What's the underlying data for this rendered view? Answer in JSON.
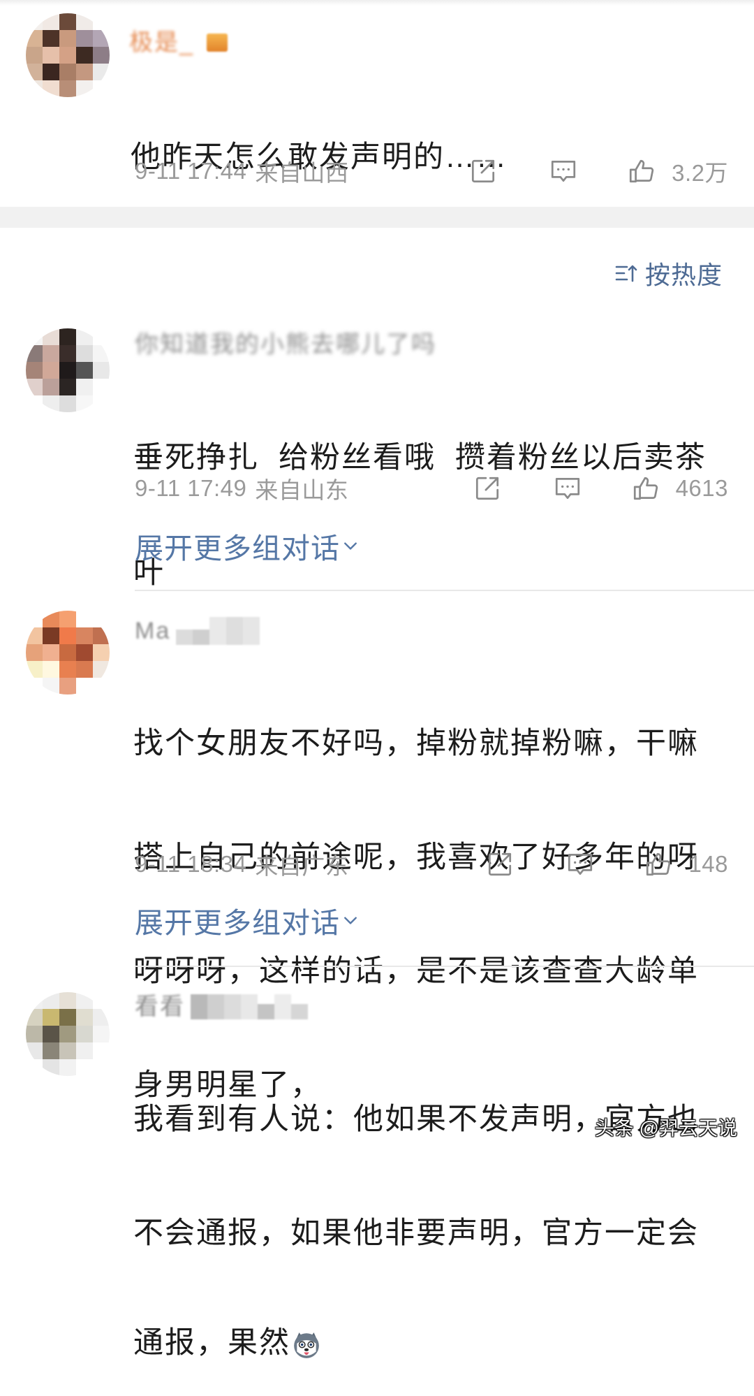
{
  "colors": {
    "text": "#1c1c1c",
    "meta": "#9a9a9a",
    "link": "#5577a6",
    "sort": "#4e6b94",
    "username_orange": "#e5894f",
    "username_gray": "#8c8c8c",
    "divider": "#e8e8e8",
    "band": "#f1f1f1"
  },
  "sort": {
    "label": "按热度",
    "icon": "sort-icon"
  },
  "icons": {
    "share": "share-icon",
    "comment": "comment-icon",
    "like": "like-icon",
    "expand": "chevron-down-icon"
  },
  "comments": [
    {
      "username": "极是_",
      "text_lines": [
        "他昨天怎么敢发声明的……"
      ],
      "time": "9-11 17:44",
      "location": "来自山西",
      "likes": "3.2万",
      "avatar_tiles": [
        "#f3efec",
        "#f1e9e4",
        "#6b4a3a",
        "#f0ebe8",
        "#ffffff",
        "#d8b394",
        "#4d3328",
        "#c99a7e",
        "#9f8f9b",
        "#b3a6b5",
        "#c9a58a",
        "#e6c0aa",
        "#d4a186",
        "#3d2a22",
        "#8d7d87",
        "#d2b29a",
        "#3b2620",
        "#a97e66",
        "#c49880",
        "#eaeaea",
        "#efe7e0",
        "#f0ddd0",
        "#b88e77",
        "#f3f0ee",
        "#ffffff"
      ]
    },
    {
      "username": "你知道我的小熊去哪儿了吗",
      "text_lines": [
        "垂死挣扎 给粉丝看哦 攒着粉丝以后卖茶",
        "叶"
      ],
      "time": "9-11 17:49",
      "location": "来自山东",
      "likes": "4613",
      "expand_label": "展开更多组对话",
      "avatar_tiles": [
        "#f5f5f5",
        "#e8dcd6",
        "#2d2420",
        "#efefef",
        "#ffffff",
        "#8a7a78",
        "#c9a89e",
        "#3a2d2a",
        "#dddddd",
        "#f5f5f5",
        "#a58478",
        "#d1a898",
        "#1f1a1a",
        "#555555",
        "#e8e8e8",
        "#e0d0cc",
        "#bba09a",
        "#2b2523",
        "#f0f0f0",
        "#ffffff",
        "#ffffff",
        "#eeeeee",
        "#dddddd",
        "#f7f7f7",
        "#ffffff"
      ]
    },
    {
      "username": "Ma",
      "text_lines": [
        "找个女朋友不好吗，掉粉就掉粉嘛，干嘛",
        "搭上自己的前途呢，我喜欢了好多年的呀",
        "呀呀呀，这样的话，是不是该查查大龄单",
        "身男明星了，"
      ],
      "time": "9-11 18:34",
      "location": "来自广东",
      "likes": "148",
      "expand_label": "展开更多组对话",
      "avatar_tiles": [
        "#ffffff",
        "#e88a5a",
        "#f5a070",
        "#ffffff",
        "#ffffff",
        "#f2c4a0",
        "#7a3a24",
        "#f07a4a",
        "#d88560",
        "#c07050",
        "#e6a27a",
        "#f0b090",
        "#c86a40",
        "#a04a30",
        "#f5d0b0",
        "#f7f0c8",
        "#fff8e0",
        "#e88050",
        "#d97a50",
        "#f0e8e0",
        "#ffffff",
        "#f5f5f5",
        "#e8a080",
        "#ffffff",
        "#ffffff"
      ]
    },
    {
      "username": "看看",
      "text_lines": [
        "我看到有人说：他如果不发声明，官方也",
        "不会通报，如果他非要声明，官方一定会",
        "通报，果然"
      ],
      "emoji": "husky-emoji-icon",
      "avatar_tiles": [
        "#f0f0f0",
        "#ececec",
        "#e6e0d6",
        "#f0f0f0",
        "#ffffff",
        "#d6d2c0",
        "#c9b870",
        "#7a7048",
        "#e0ddd0",
        "#eeeeee",
        "#bcb8a8",
        "#5a5448",
        "#a09a80",
        "#d8d8d0",
        "#f5f5f5",
        "#e8e8e8",
        "#8a8578",
        "#c8c4b8",
        "#f0f0f0",
        "#ffffff",
        "#ffffff",
        "#e4e4e4",
        "#f2f2f2",
        "#ffffff",
        "#ffffff"
      ]
    }
  ],
  "watermark": "头条 @羿云天说"
}
